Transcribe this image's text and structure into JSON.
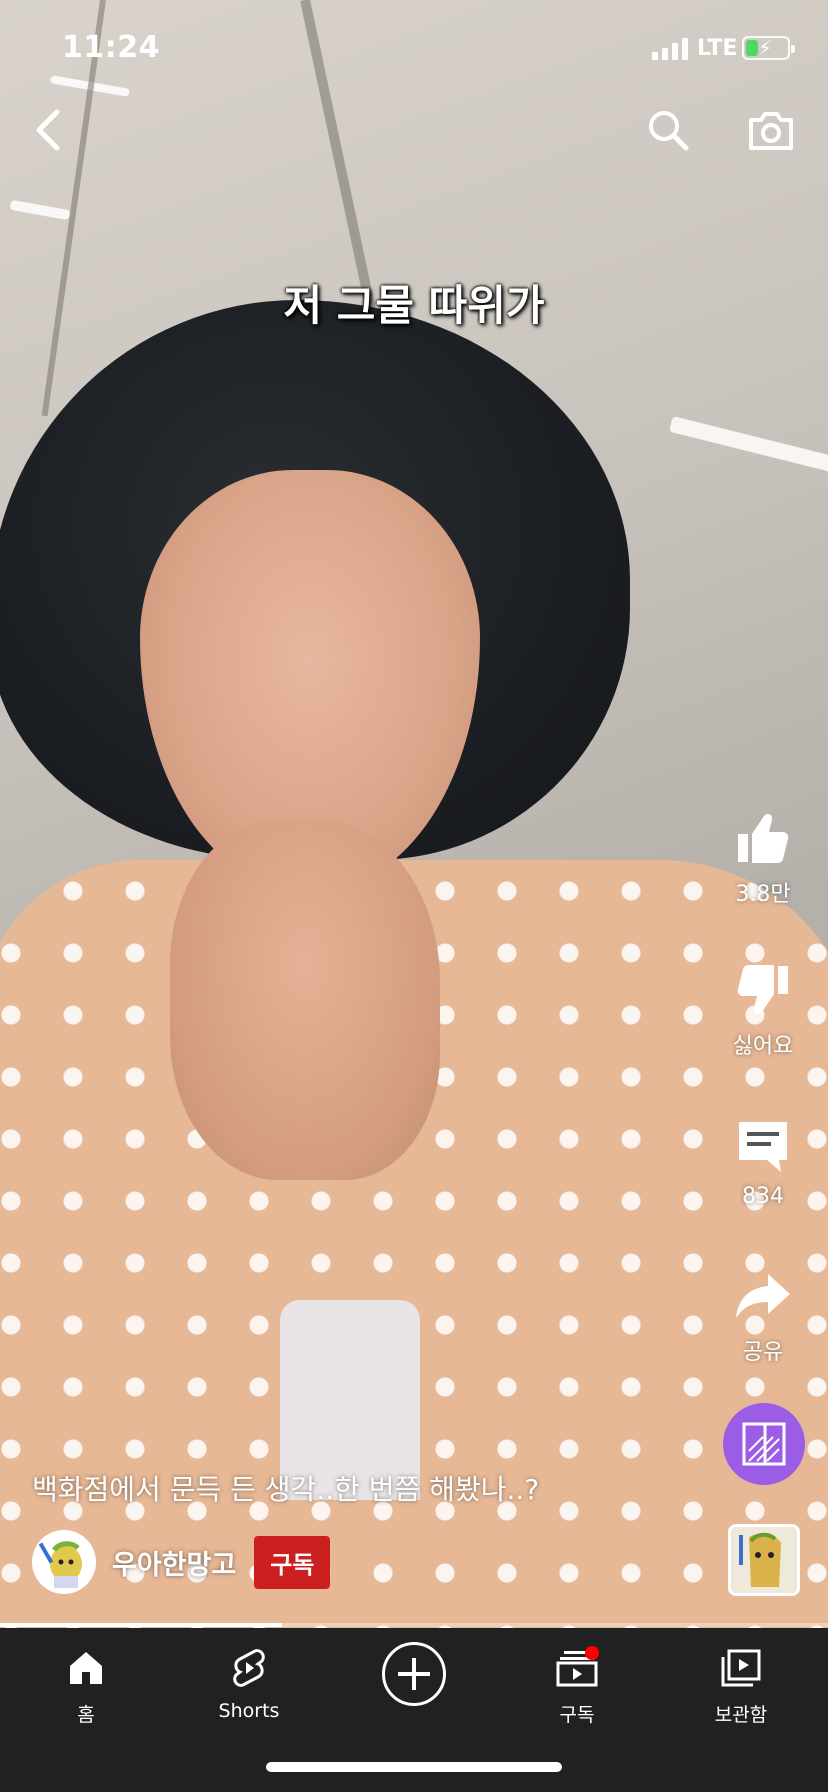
{
  "status_bar": {
    "time": "11:24",
    "network": "LTE",
    "battery_level": 0.3,
    "charging": true
  },
  "top_bar": {
    "back_icon": "chevron-left-icon",
    "search_icon": "search-icon",
    "camera_icon": "camera-icon"
  },
  "video": {
    "caption": "저 그물 따위가",
    "title": "백화점에서 문득 든 생각..한 번쯤 해봤나..?",
    "progress": 0.34
  },
  "actions": {
    "like_count": "3.8만",
    "dislike_label": "싫어요",
    "comment_count": "834",
    "share_label": "공유",
    "remix_icon": "remix-icon",
    "remix_color": "#9b5de5"
  },
  "channel": {
    "name": "우아한망고",
    "subscribe_label": "구독",
    "subscribe_color": "#cc1f1f"
  },
  "nav": {
    "items": [
      {
        "label": "홈",
        "icon": "home-icon"
      },
      {
        "label": "Shorts",
        "icon": "shorts-icon"
      },
      {
        "label": "",
        "icon": "create-plus-icon"
      },
      {
        "label": "구독",
        "icon": "subscriptions-icon",
        "badge": true
      },
      {
        "label": "보관함",
        "icon": "library-icon"
      }
    ],
    "background": "#212121"
  }
}
